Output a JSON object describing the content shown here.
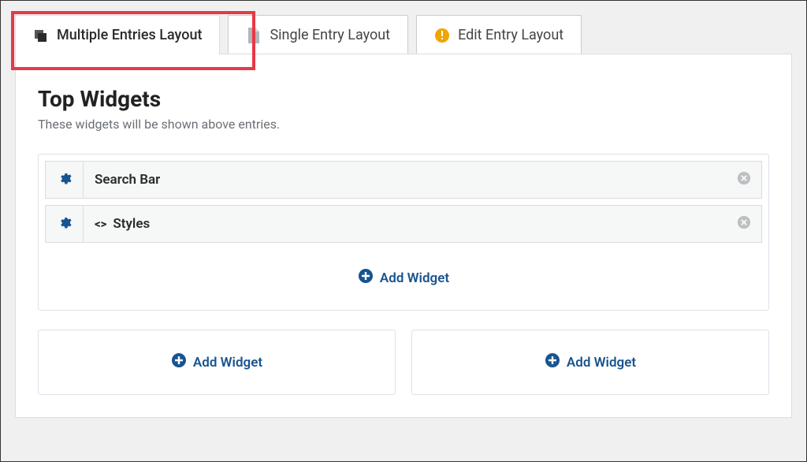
{
  "tabs": {
    "multiple": "Multiple Entries Layout",
    "single": "Single Entry Layout",
    "edit": "Edit Entry Layout"
  },
  "section": {
    "title": "Top Widgets",
    "desc": "These widgets will be shown above entries."
  },
  "widgets": {
    "search_bar": "Search Bar",
    "styles": "Styles"
  },
  "buttons": {
    "add_widget": "Add Widget"
  },
  "colors": {
    "accent": "#18548f",
    "highlight": "#e63946",
    "warning": "#f0a500"
  }
}
